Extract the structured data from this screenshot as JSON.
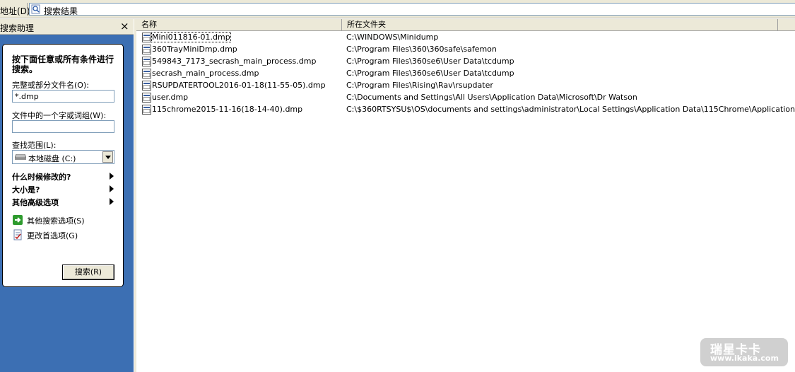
{
  "address_bar": {
    "label": "地址(D)",
    "value": "搜索结果"
  },
  "search_pane": {
    "title": "搜索助理",
    "close_symbol": "×",
    "instructions": "按下面任意或所有条件进行搜索。",
    "filename_label": "完整或部分文件名(O):",
    "filename_value": "*.dmp",
    "phrase_label": "文件中的一个字或词组(W):",
    "phrase_value": "",
    "lookin_label": "查找范围(L):",
    "lookin_value": "本地磁盘 (C:)",
    "when_modified": "什么时候修改的?",
    "size": "大小是?",
    "more_advanced": "其他高级选项",
    "other_search_options": "其他搜索选项(S)",
    "change_preferences": "更改首选项(G)",
    "search_button": "搜索(R)"
  },
  "results": {
    "columns": [
      "名称",
      "所在文件夹"
    ],
    "rows": [
      {
        "name": "Mini011816-01.dmp",
        "folder": "C:\\WINDOWS\\Minidump"
      },
      {
        "name": "360TrayMiniDmp.dmp",
        "folder": "C:\\Program Files\\360\\360safe\\safemon"
      },
      {
        "name": "549843_7173_secrash_main_process.dmp",
        "folder": "C:\\Program Files\\360se6\\User Data\\tcdump"
      },
      {
        "name": "secrash_main_process.dmp",
        "folder": "C:\\Program Files\\360se6\\User Data\\tcdump"
      },
      {
        "name": "RSUPDATERTOOL2016-01-18(11-55-05).dmp",
        "folder": "C:\\Program Files\\Rising\\Rav\\rsupdater"
      },
      {
        "name": "user.dmp",
        "folder": "C:\\Documents and Settings\\All Users\\Application Data\\Microsoft\\Dr Watson"
      },
      {
        "name": "115chrome2015-11-16(18-14-40).dmp",
        "folder": "C:\\$360RTSYSU$\\OS\\documents and settings\\administrator\\Local Settings\\Application Data\\115Chrome\\Application"
      }
    ]
  },
  "watermark": {
    "title": "瑞星卡卡",
    "url": "www.ikaka.com"
  },
  "colors": {
    "pane_blue": "#3c6fb3",
    "chrome": "#ece9d8"
  }
}
